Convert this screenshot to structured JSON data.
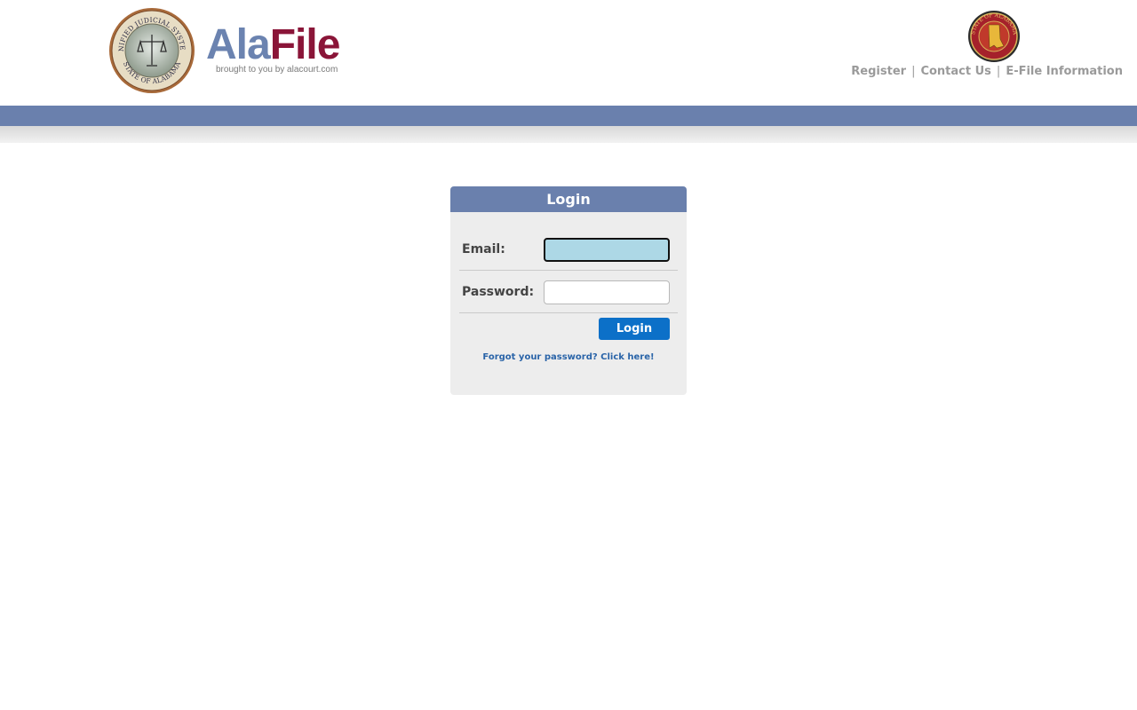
{
  "header": {
    "brand_part1": "Ala",
    "brand_part2": "File",
    "tagline": "brought to you by alacourt.com",
    "left_seal": {
      "icon": "unified-judicial-system-seal-icon",
      "top_text": "UNIFIED JUDICIAL SYSTEM",
      "bottom_text": "STATE OF ALABAMA"
    },
    "right_seal": {
      "icon": "state-of-alabama-seal-icon",
      "text": "STATE OF ALABAMA"
    },
    "links": {
      "register": "Register",
      "contact": "Contact Us",
      "efile": "E-File Information",
      "separator": "|"
    },
    "colors": {
      "brand_blue": "#6b83b0",
      "brand_red": "#8a1538",
      "band_blue": "#6a80ad"
    }
  },
  "login": {
    "title": "Login",
    "email_label": "Email:",
    "email_value": "",
    "password_label": "Password:",
    "password_value": "",
    "submit_label": "Login",
    "forgot_link": "Forgot your password? Click here!",
    "colors": {
      "button": "#0c70c8",
      "focused_field": "#add8e6"
    }
  }
}
